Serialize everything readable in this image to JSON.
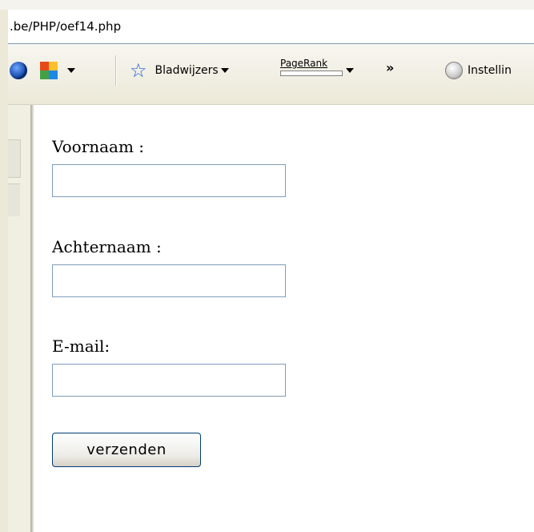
{
  "address_bar": {
    "url": ".be/PHP/oef14.php"
  },
  "toolbar": {
    "bookmarks_label": "Bladwijzers",
    "pagerank_label": "PageRank",
    "overflow_label": "»",
    "settings_label": "Instellin"
  },
  "form": {
    "first_name_label": "Voornaam :",
    "first_name_value": "",
    "last_name_label": "Achternaam :",
    "last_name_value": "",
    "email_label": "E-mail:",
    "email_value": "",
    "submit_label": "verzenden"
  },
  "colors": {
    "input_border": "#7f9db9",
    "button_border": "#003c74",
    "toolbar_bg": "#ece9d8"
  }
}
